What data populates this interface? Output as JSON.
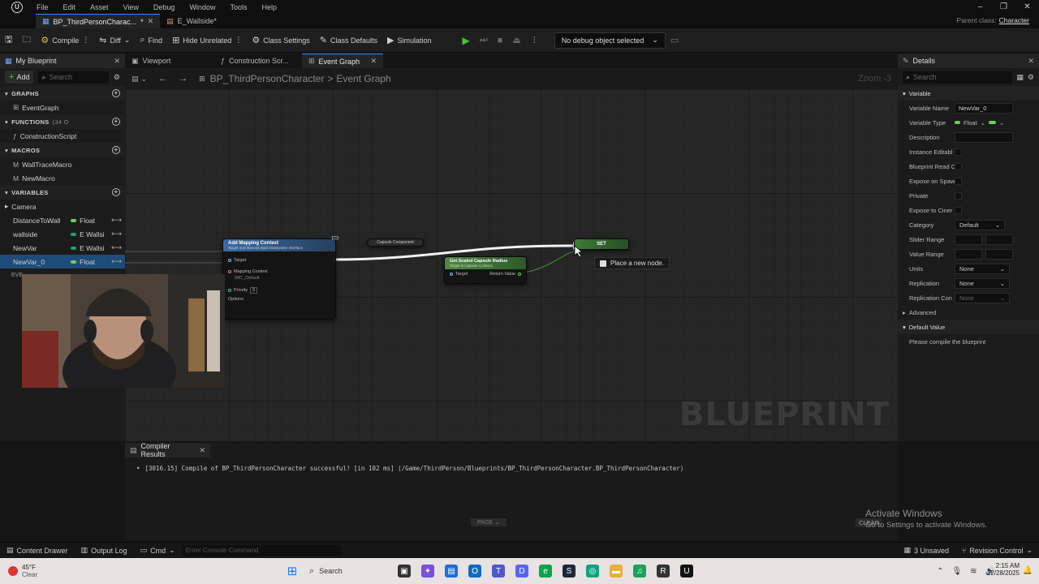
{
  "menubar": {
    "items": [
      "File",
      "Edit",
      "Asset",
      "View",
      "Debug",
      "Window",
      "Tools",
      "Help"
    ]
  },
  "doc_tabs": [
    {
      "label": "BP_ThirdPersonCharac...",
      "modified": "*",
      "active": true
    },
    {
      "label": "E_Wallside*",
      "active": false
    }
  ],
  "parent_class": {
    "label": "Parent class:",
    "value": "Character"
  },
  "toolbar": {
    "compile": "Compile",
    "diff": "Diff",
    "find": "Find",
    "hide_unrelated": "Hide Unrelated",
    "class_settings": "Class Settings",
    "class_defaults": "Class Defaults",
    "simulation": "Simulation",
    "debug_object": "No debug object selected"
  },
  "my_blueprint": {
    "tab": "My Blueprint",
    "add": "Add",
    "search_placeholder": "Search",
    "graphs_header": "GRAPHS",
    "graphs": [
      "EventGraph"
    ],
    "functions_header": "FUNCTIONS",
    "functions_count": "(34 O",
    "functions": [
      "ConstructionScript"
    ],
    "macros_header": "MACROS",
    "macros": [
      "WallTraceMacro",
      "NewMacro"
    ],
    "variables_header": "VARIABLES",
    "camera_category": "Camera",
    "variables": [
      {
        "name": "DistanceToWall",
        "type": "Float",
        "color": "#6ad14c",
        "selected": false
      },
      {
        "name": "wallside",
        "type": "E Wallsi",
        "color": "#1aa07d",
        "selected": false
      },
      {
        "name": "NewVar",
        "type": "E Wallsi",
        "color": "#1aa07d",
        "selected": false
      },
      {
        "name": "NewVar_0",
        "type": "Float",
        "color": "#6ad14c",
        "selected": true
      }
    ],
    "event_dispatchers_short": "EVE"
  },
  "graph_tabs": [
    {
      "label": "Viewport",
      "active": false
    },
    {
      "label": "Construction Scr...",
      "active": false
    },
    {
      "label": "Event Graph",
      "active": true
    }
  ],
  "breadcrumb": {
    "root": "BP_ThirdPersonCharacter",
    "sep": ">",
    "current": "Event Graph"
  },
  "zoom": "Zoom -3",
  "nodes": {
    "add_mapping": {
      "title": "Add Mapping Context",
      "subtitle": "Target is Enhanced Input Subsystem Interface",
      "pins": [
        "Target",
        "Mapping Context",
        "IMC_Default",
        "Priority",
        "0",
        "Options"
      ]
    },
    "capsule": {
      "title": "Capsule Component"
    },
    "scaled_radius": {
      "title": "Get Scaled Capsule Radius",
      "subtitle": "Target is Capsule Collision",
      "in_pin": "Target",
      "out_pin": "Return Value"
    },
    "set": {
      "title": "SET"
    },
    "tooltip": "Place a new node."
  },
  "watermark": "BLUEPRINT",
  "details": {
    "tab": "Details",
    "search_placeholder": "Search",
    "variable_section": "Variable",
    "rows": {
      "variable_name": {
        "label": "Variable Name",
        "value": "NewVar_0"
      },
      "variable_type": {
        "label": "Variable Type",
        "value": "Float"
      },
      "description": {
        "label": "Description"
      },
      "instance_editable": {
        "label": "Instance Editabl"
      },
      "blueprint_read_only": {
        "label": "Blueprint Read C"
      },
      "expose_on_spawn": {
        "label": "Expose on Spaw"
      },
      "private": {
        "label": "Private"
      },
      "expose_cinematics": {
        "label": "Expose to Ciner"
      },
      "category": {
        "label": "Category",
        "value": "Default"
      },
      "slider_range": {
        "label": "Slider Range"
      },
      "value_range": {
        "label": "Value Range"
      },
      "units": {
        "label": "Units",
        "value": "None"
      },
      "replication": {
        "label": "Replication",
        "value": "None"
      },
      "replication_condition": {
        "label": "Replication Con",
        "value": "None"
      }
    },
    "advanced": "Advanced",
    "default_value_section": "Default Value",
    "compile_message": "Please compile the blueprint"
  },
  "compiler": {
    "tab": "Compiler Results",
    "message": "[3016.15] Compile of BP_ThirdPersonCharacter successful! [in 102 ms] (/Game/ThirdPerson/Blueprints/BP_ThirdPersonCharacter.BP_ThirdPersonCharacter)",
    "page": "PAGE",
    "clear": "CLEAR"
  },
  "activate_windows": {
    "title": "Activate Windows",
    "subtitle": "Go to Settings to activate Windows."
  },
  "statusbar": {
    "content_drawer": "Content Drawer",
    "output_log": "Output Log",
    "cmd": "Cmd",
    "console_placeholder": "Enter Console Command",
    "unsaved": "3 Unsaved",
    "revision_control": "Revision Control"
  },
  "taskbar": {
    "weather_temp": "45°F",
    "weather_desc": "Clear",
    "search": "Search",
    "time": "2:15 AM",
    "date": "12/28/2025"
  }
}
